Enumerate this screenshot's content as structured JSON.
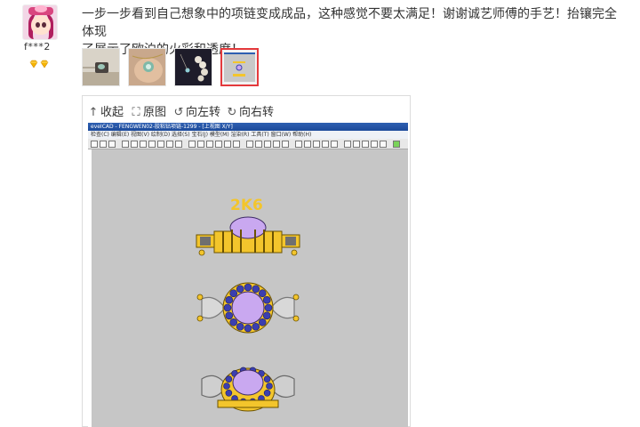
{
  "user": {
    "avatar_icon": "avatar-icon",
    "name": "f***2",
    "level_icon": "diamond-level-icon",
    "level_color": "#f5b400"
  },
  "review": {
    "line1": "一步一步看到自己想象中的项链变成成品，这种感觉不要太满足！谢谢诚艺师傅的手艺！抬镶完全体现",
    "line2": "了展示了欧泊的火彩和透度！"
  },
  "thumbnails": {
    "count": 4,
    "active_index": 3,
    "active_border_color": "#e4393c"
  },
  "viewer": {
    "tools": {
      "collapse": {
        "icon": "collapse-arrow-icon",
        "label": "收起"
      },
      "original": {
        "icon": "fullscreen-icon",
        "label": "原图"
      },
      "rotate_left": {
        "icon": "rotate-left-icon",
        "label": "向左转"
      },
      "rotate_right": {
        "icon": "rotate-right-icon",
        "label": "向右转"
      }
    },
    "cad": {
      "window_title": "eveICAD - FENGWEN02-胶粘钻项链-1299 - [上视图 X/Y]",
      "menu": "检查(C)  编辑(E)  视图(V)  绘制(D)  选择(S)  宝石(J)  模型(M)  渲染(R)  工具(T)  窗口(W)  帮助(H)",
      "metal_label": "2K6",
      "metal_color": "#f3c52c",
      "gem_color": "#c9a8f0",
      "side_stone_color": "#3b3fb0",
      "background_color": "#c6c6c6"
    }
  }
}
